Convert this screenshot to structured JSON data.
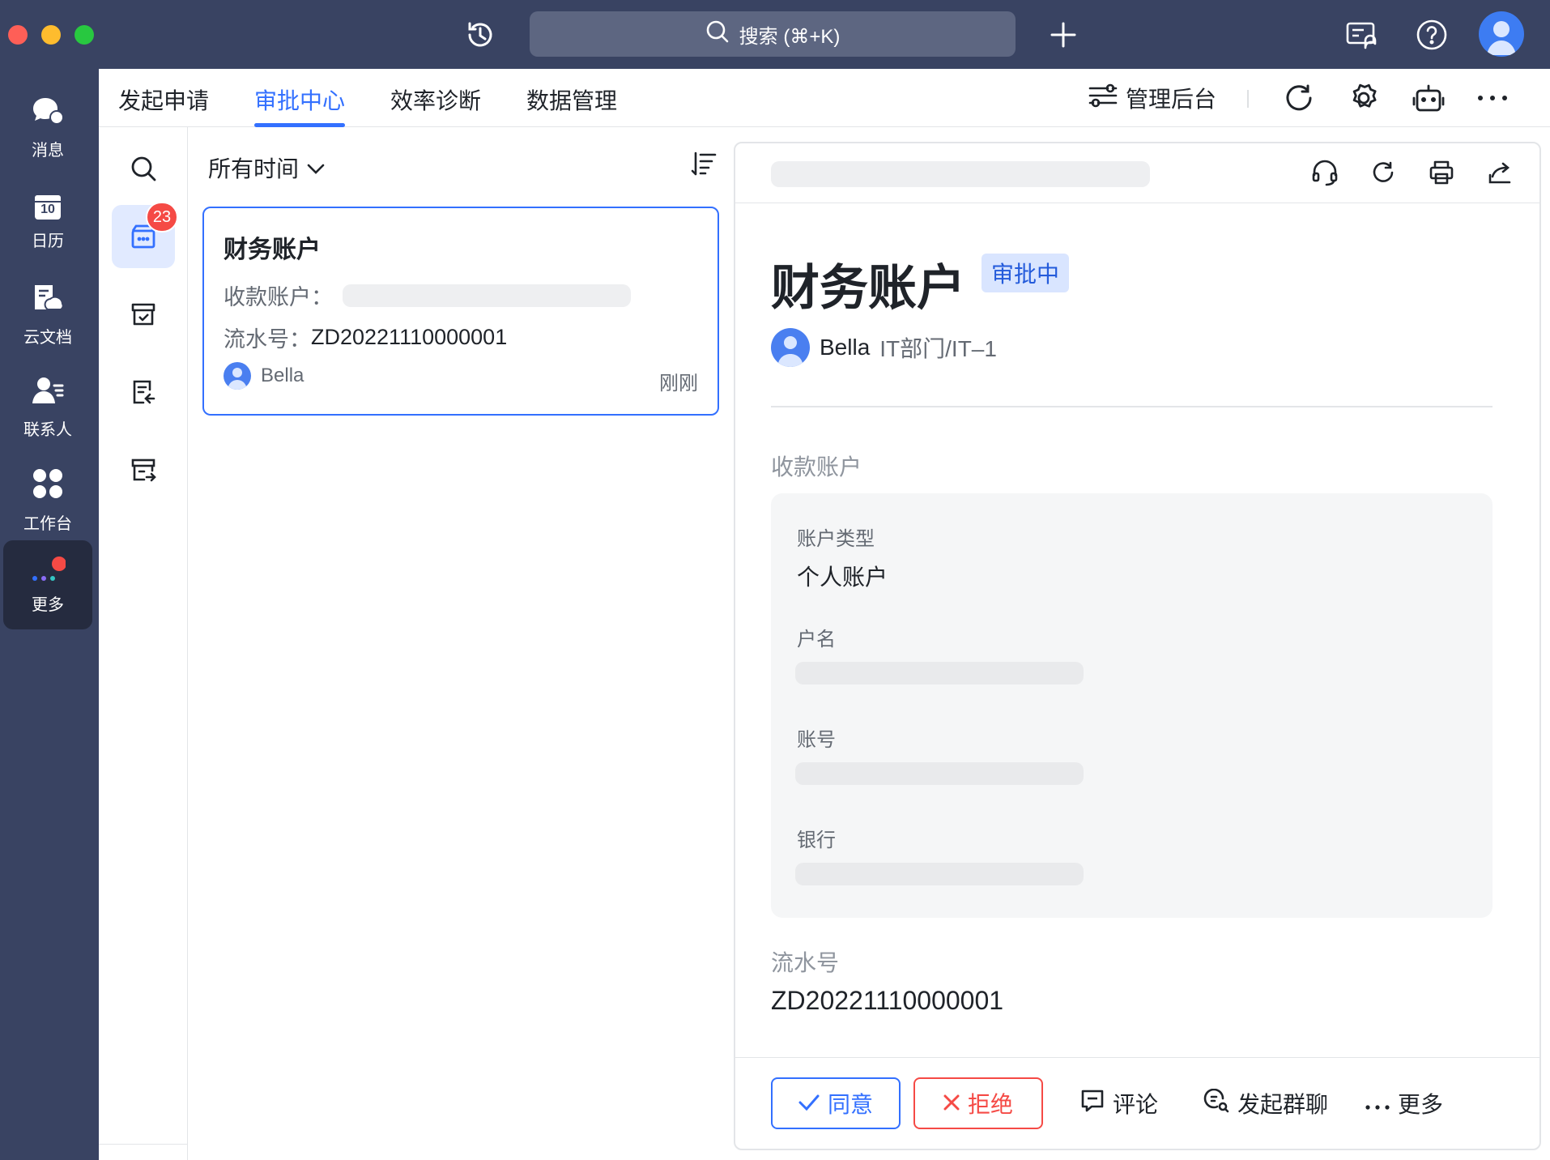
{
  "titlebar": {
    "search_placeholder": "搜索 (⌘+K)",
    "icons": [
      "history-icon",
      "search-icon",
      "add-icon",
      "announcement-icon",
      "help-icon",
      "avatar"
    ]
  },
  "rail": {
    "items": [
      {
        "label": "消息",
        "icon": "chat-icon"
      },
      {
        "label": "日历",
        "icon": "calendar-icon",
        "calendar_day": "10"
      },
      {
        "label": "云文档",
        "icon": "cloud-doc-icon"
      },
      {
        "label": "联系人",
        "icon": "contacts-icon"
      },
      {
        "label": "工作台",
        "icon": "workplace-icon"
      },
      {
        "label": "更多",
        "icon": "more-dots-icon"
      }
    ]
  },
  "topnav": {
    "tabs": [
      {
        "label": "发起申请"
      },
      {
        "label": "审批中心",
        "active": true
      },
      {
        "label": "效率诊断"
      },
      {
        "label": "数据管理"
      }
    ],
    "admin_label": "管理后台"
  },
  "subside": {
    "pending_badge": "23"
  },
  "list": {
    "filter_label": "所有时间",
    "card": {
      "title": "财务账户",
      "payee_label": "收款账户：",
      "serial_label": "流水号：",
      "serial_value": "ZD20221110000001",
      "user": "Bella",
      "time": "刚刚"
    }
  },
  "detail": {
    "title": "财务账户",
    "status": "审批中",
    "applicant": "Bella",
    "department": "IT部门/IT–1",
    "payee_section": "收款账户",
    "fields": {
      "account_type_label": "账户类型",
      "account_type_value": "个人账户",
      "account_name_label": "户名",
      "account_no_label": "账号",
      "bank_label": "银行"
    },
    "serial_section": "流水号",
    "serial_value": "ZD20221110000001",
    "actions": {
      "approve": "同意",
      "reject": "拒绝",
      "comment": "评论",
      "group_chat": "发起群聊",
      "more": "更多"
    }
  },
  "colors": {
    "rail_bg": "#394362",
    "accent": "#3370ff",
    "danger": "#f54a45",
    "status_tag_bg": "#d9e5ff"
  }
}
